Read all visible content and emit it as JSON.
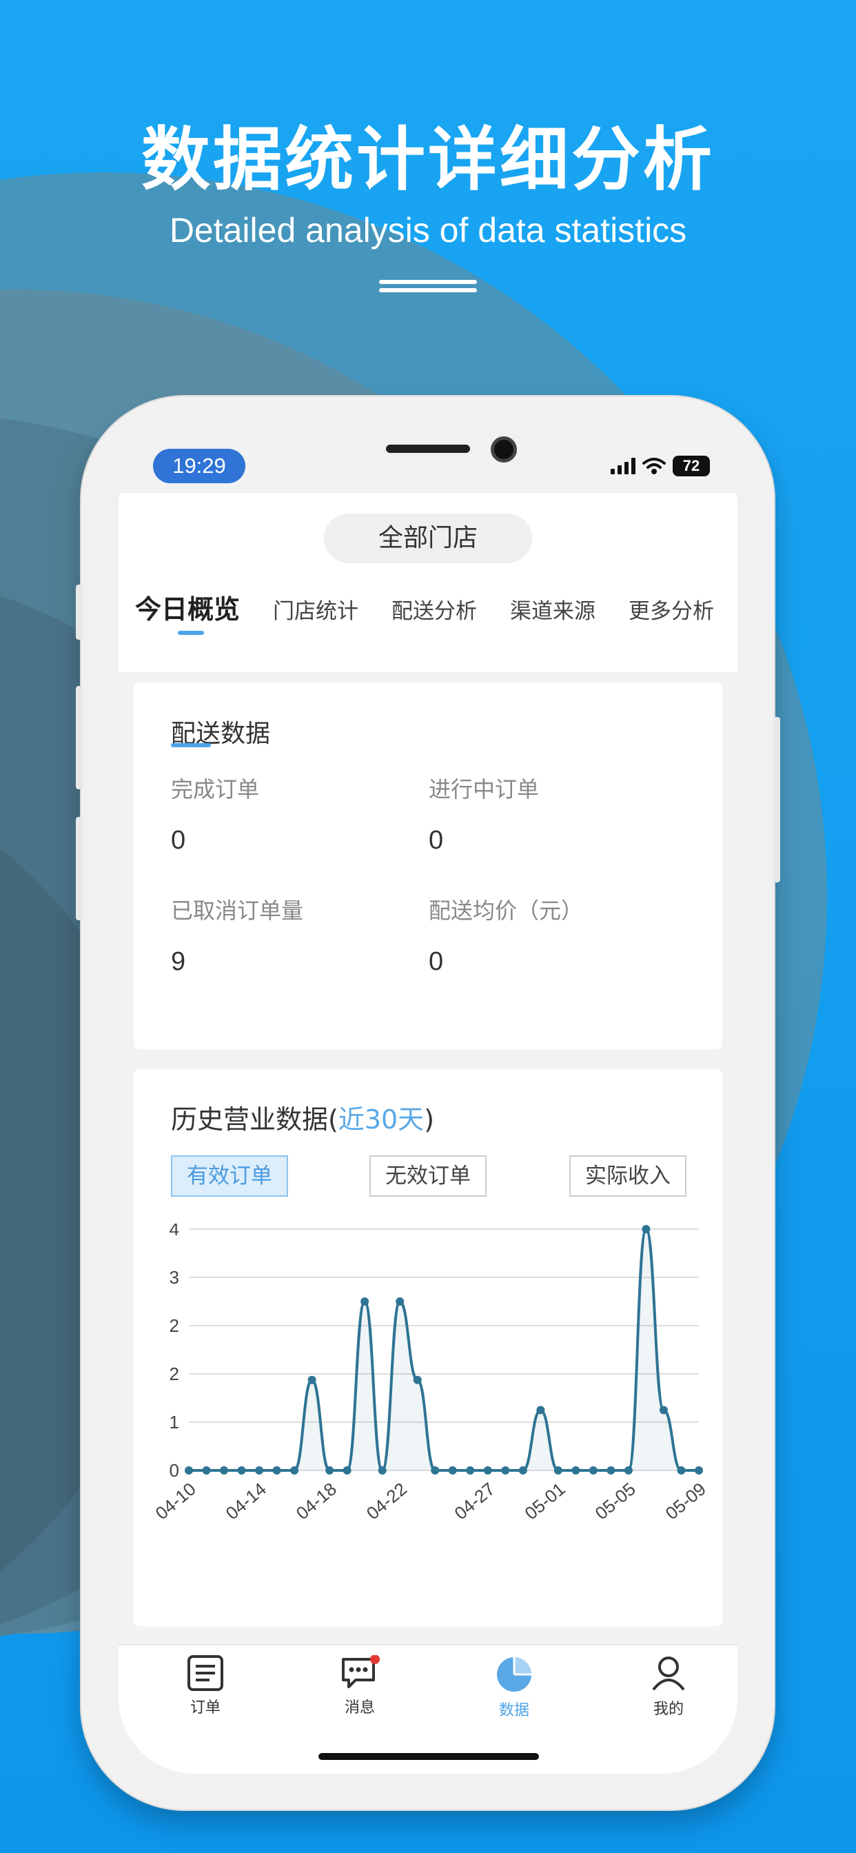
{
  "hero": {
    "title": "数据统计详细分析",
    "subtitle": "Detailed analysis of data statistics"
  },
  "status_bar": {
    "time": "19:29",
    "battery": "72"
  },
  "header": {
    "store_selector": "全部门店",
    "tabs": [
      {
        "label": "今日概览",
        "active": true
      },
      {
        "label": "门店统计"
      },
      {
        "label": "配送分析"
      },
      {
        "label": "渠道来源"
      },
      {
        "label": "更多分析"
      }
    ]
  },
  "delivery": {
    "title": "配送数据",
    "completed_label": "完成订单",
    "completed_value": "0",
    "in_progress_label": "进行中订单",
    "in_progress_value": "0",
    "cancelled_label": "已取消订单量",
    "cancelled_value": "9",
    "avg_price_label": "配送均价（元）",
    "avg_price_value": "0"
  },
  "history": {
    "title_prefix": "历史营业数据(",
    "title_highlight": "近30天",
    "title_suffix": ")",
    "buttons": [
      {
        "label": "有效订单",
        "active": true
      },
      {
        "label": "无效订单"
      },
      {
        "label": "实际收入"
      }
    ]
  },
  "chart_data": {
    "type": "line",
    "x": [
      "04-10",
      "04-11",
      "04-12",
      "04-13",
      "04-14",
      "04-15",
      "04-16",
      "04-17",
      "04-18",
      "04-19",
      "04-20",
      "04-21",
      "04-22",
      "04-23",
      "04-24",
      "04-25",
      "04-26",
      "04-27",
      "04-28",
      "04-29",
      "04-30",
      "05-01",
      "05-02",
      "05-03",
      "05-04",
      "05-05",
      "05-06",
      "05-07",
      "05-08",
      "05-09"
    ],
    "series": [
      {
        "values": [
          0,
          0,
          0,
          0,
          0,
          0,
          0,
          1.5,
          0,
          0,
          2.8,
          0,
          2.8,
          1.5,
          0,
          0,
          0,
          0,
          0,
          0,
          1,
          0,
          0,
          0,
          0,
          0,
          4,
          1,
          0,
          0
        ]
      }
    ],
    "x_tick_labels": [
      "04-10",
      "04-14",
      "04-18",
      "04-22",
      "04-27",
      "05-01",
      "05-05",
      "05-09"
    ],
    "y_tick_labels": [
      "0",
      "1",
      "2",
      "2",
      "3",
      "4"
    ],
    "ylim": [
      0,
      4
    ],
    "grid": true,
    "color": "#2e7494"
  },
  "bottom_nav": [
    {
      "label": "订单",
      "icon": "order-icon"
    },
    {
      "label": "消息",
      "icon": "message-icon",
      "badge": true
    },
    {
      "label": "数据",
      "icon": "pie-chart-icon",
      "active": true
    },
    {
      "label": "我的",
      "icon": "profile-icon"
    }
  ],
  "colors": {
    "accent": "#4ea3e8",
    "background": "#0e9cf0",
    "badge": "#e53935"
  }
}
